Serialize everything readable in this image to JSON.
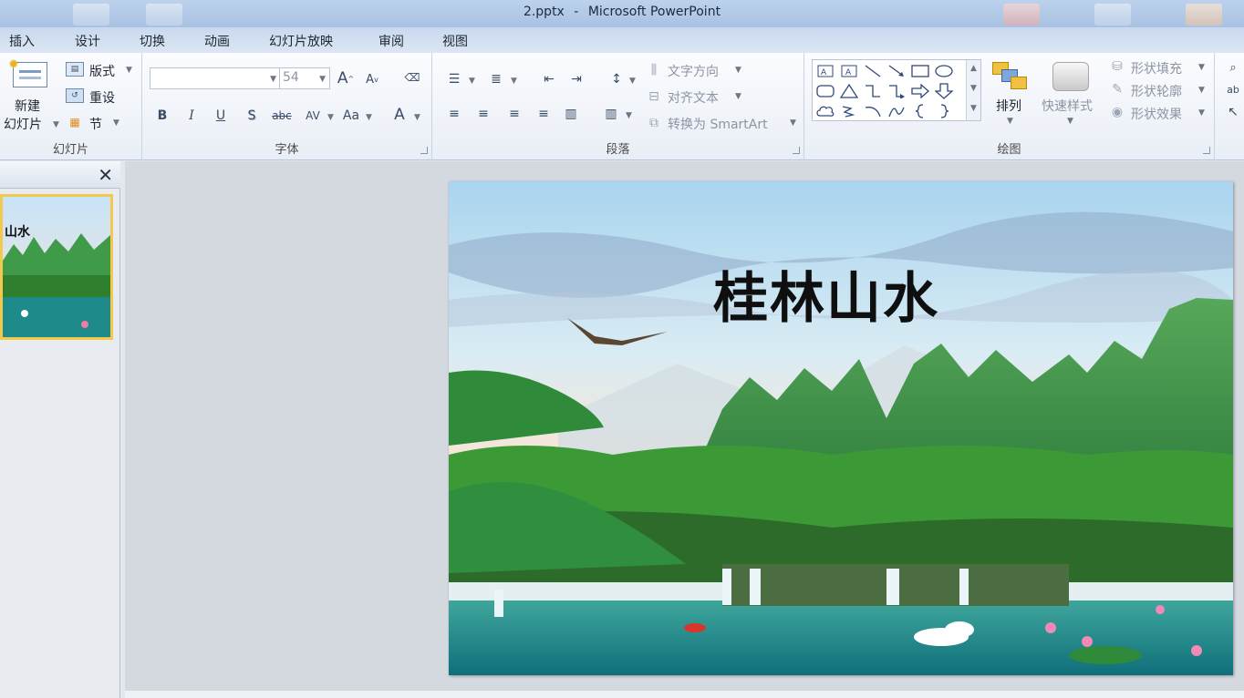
{
  "window": {
    "file_name": "2.pptx",
    "separator": "-",
    "app_name": "Microsoft PowerPoint"
  },
  "tabs": [
    "插入",
    "设计",
    "切换",
    "动画",
    "幻灯片放映",
    "审阅",
    "视图"
  ],
  "ribbon": {
    "slides_group": {
      "label": "幻灯片",
      "new_slide_line1": "新建",
      "new_slide_line2": "幻灯片",
      "layout": "版式",
      "reset": "重设",
      "section": "节"
    },
    "font_group": {
      "label": "字体",
      "font_name": "",
      "font_size": "54",
      "bold": "B",
      "italic": "I",
      "underline": "U",
      "shadow": "S",
      "strikethrough": "abc",
      "spacing": "AV",
      "case": "Aa",
      "color": "A"
    },
    "paragraph_group": {
      "label": "段落",
      "text_direction": "文字方向",
      "align_text": "对齐文本",
      "smartart": "转换为 SmartArt"
    },
    "drawing_group": {
      "label": "绘图",
      "arrange": "排列",
      "quick_styles": "快速样式",
      "shape_fill": "形状填充",
      "shape_outline": "形状轮廓",
      "shape_effects": "形状效果"
    }
  },
  "slide": {
    "title": "桂林山水"
  },
  "thumbnail": {
    "title_fragment": "山水"
  },
  "colors": {
    "selection": "#f2c94c",
    "ribbon_bg": "#f4f7fb",
    "canvas_bg": "#d4d9e0"
  }
}
